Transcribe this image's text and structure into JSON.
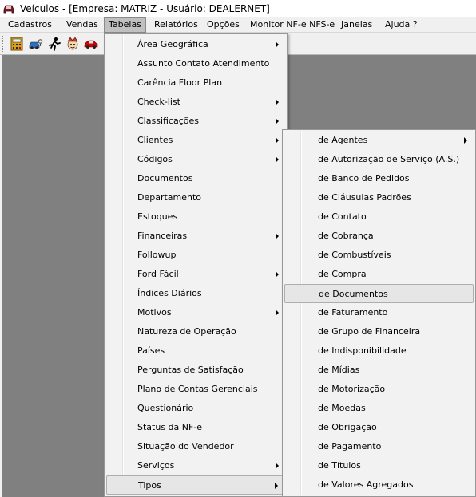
{
  "window": {
    "title": "Veículos - [Empresa: MATRIZ - Usuário: DEALERNET]",
    "app_icon": "car-logo-icon"
  },
  "menubar": [
    {
      "label": "Cadastros",
      "active": false
    },
    {
      "label": "Vendas",
      "active": false
    },
    {
      "label": "Tabelas",
      "active": true
    },
    {
      "label": "Relatórios",
      "active": false
    },
    {
      "label": "Opções",
      "active": false
    },
    {
      "label": "Monitor NF-e NFS-e",
      "active": false
    },
    {
      "label": "Janelas",
      "active": false
    },
    {
      "label": "Ajuda ?",
      "active": false
    }
  ],
  "toolbar": [
    {
      "icon": "calculator-icon",
      "color": "#d4a017"
    },
    {
      "icon": "car-key-icon",
      "color": "#2f6fbf"
    },
    {
      "icon": "running-person-icon",
      "color": "#000000"
    },
    {
      "icon": "mascot-icon",
      "color": "#c0392b"
    },
    {
      "icon": "red-car-icon",
      "color": "#d40000"
    }
  ],
  "tabelas_menu": [
    {
      "label": "Área Geográfica",
      "submenu": true
    },
    {
      "label": "Assunto Contato Atendimento",
      "submenu": false
    },
    {
      "label": "Carência Floor Plan",
      "submenu": false
    },
    {
      "label": "Check-list",
      "submenu": true
    },
    {
      "label": "Classificações",
      "submenu": true
    },
    {
      "label": "Clientes",
      "submenu": true
    },
    {
      "label": "Códigos",
      "submenu": true
    },
    {
      "label": "Documentos",
      "submenu": false
    },
    {
      "label": "Departamento",
      "submenu": false
    },
    {
      "label": "Estoques",
      "submenu": false
    },
    {
      "label": "Financeiras",
      "submenu": true
    },
    {
      "label": "Followup",
      "submenu": false
    },
    {
      "label": "Ford Fácil",
      "submenu": true
    },
    {
      "label": "Índices Diários",
      "submenu": false
    },
    {
      "label": "Motivos",
      "submenu": true
    },
    {
      "label": "Natureza de Operação",
      "submenu": false
    },
    {
      "label": "Países",
      "submenu": false
    },
    {
      "label": "Perguntas de Satisfação",
      "submenu": false
    },
    {
      "label": "Plano de Contas Gerenciais",
      "submenu": false
    },
    {
      "label": "Questionário",
      "submenu": false
    },
    {
      "label": "Status da NF-e",
      "submenu": false
    },
    {
      "label": "Situação do Vendedor",
      "submenu": false
    },
    {
      "label": "Serviços",
      "submenu": true
    },
    {
      "label": "Tipos",
      "submenu": true,
      "highlighted": true
    }
  ],
  "tipos_menu": [
    {
      "label": "de Agentes",
      "submenu": true
    },
    {
      "label": "de Autorização de Serviço (A.S.)",
      "submenu": false
    },
    {
      "label": "de Banco de Pedidos",
      "submenu": false
    },
    {
      "label": "de Cláusulas Padrões",
      "submenu": false
    },
    {
      "label": "de Contato",
      "submenu": false
    },
    {
      "label": "de Cobrança",
      "submenu": false
    },
    {
      "label": "de Combustíveis",
      "submenu": false
    },
    {
      "label": "de Compra",
      "submenu": false
    },
    {
      "label": "de Documentos",
      "submenu": false,
      "highlighted": true
    },
    {
      "label": "de Faturamento",
      "submenu": false
    },
    {
      "label": "de Grupo de Financeira",
      "submenu": false
    },
    {
      "label": "de Indisponibilidade",
      "submenu": false
    },
    {
      "label": "de Mídias",
      "submenu": false
    },
    {
      "label": "de Motorização",
      "submenu": false
    },
    {
      "label": "de Moedas",
      "submenu": false
    },
    {
      "label": "de Obrigação",
      "submenu": false
    },
    {
      "label": "de Pagamento",
      "submenu": false
    },
    {
      "label": "de Títulos",
      "submenu": false
    },
    {
      "label": "de Valores Agregados",
      "submenu": false
    }
  ]
}
